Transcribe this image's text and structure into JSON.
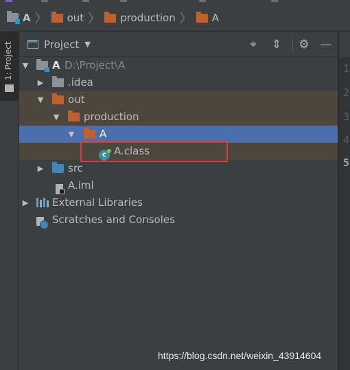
{
  "breadcrumbs": [
    {
      "label": "A",
      "icon": "project-folder-icon"
    },
    {
      "label": "out",
      "icon": "folder-icon"
    },
    {
      "label": "production",
      "icon": "folder-icon"
    },
    {
      "label": "A",
      "icon": "folder-icon"
    }
  ],
  "toolwindow_tab": {
    "label": "1: Project"
  },
  "panel": {
    "title": "Project",
    "dropdown_glyph": "▼",
    "buttons": {
      "locate": "⌖",
      "collapse": "⇕",
      "settings": "⚙",
      "hide": "—"
    }
  },
  "tree": {
    "root": {
      "name": "A",
      "path": "D:\\Project\\A"
    },
    "idea": ".idea",
    "out": "out",
    "production": "production",
    "module_dir": "A",
    "class_file": "A.class",
    "src": "src",
    "iml": "A.iml",
    "external_libraries": "External Libraries",
    "scratches": "Scratches and Consoles"
  },
  "gutter_lines": [
    "1",
    "2",
    "3",
    "4",
    "5"
  ],
  "watermark": "https://blog.csdn.net/weixin_43914604",
  "colors": {
    "selection": "#4b6eaf",
    "excluded_highlight": "#4d463c",
    "annotation_box": "#e03c3c",
    "excluded_folder": "#c0602f",
    "source_folder": "#3f87b8"
  }
}
